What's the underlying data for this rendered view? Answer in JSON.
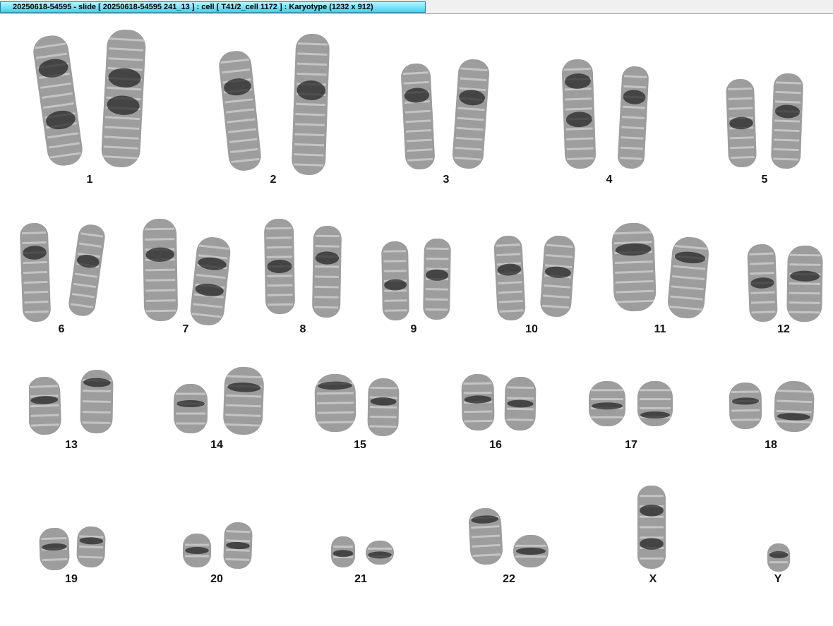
{
  "window": {
    "title": "20250618-54595 - slide [ 20250618-54595 241_13 ] : cell [ T41/2_cell 1172 ] : Karyotype  (1232 x 912)"
  },
  "karyotype": {
    "chromosomes": [
      {
        "label": "1"
      },
      {
        "label": "2"
      },
      {
        "label": "3"
      },
      {
        "label": "4"
      },
      {
        "label": "5"
      },
      {
        "label": "6"
      },
      {
        "label": "7"
      },
      {
        "label": "8"
      },
      {
        "label": "9"
      },
      {
        "label": "10"
      },
      {
        "label": "11"
      },
      {
        "label": "12"
      },
      {
        "label": "13"
      },
      {
        "label": "14"
      },
      {
        "label": "15"
      },
      {
        "label": "16"
      },
      {
        "label": "17"
      },
      {
        "label": "18"
      },
      {
        "label": "19"
      },
      {
        "label": "20"
      },
      {
        "label": "21"
      },
      {
        "label": "22"
      },
      {
        "label": "X"
      },
      {
        "label": "Y"
      }
    ]
  }
}
